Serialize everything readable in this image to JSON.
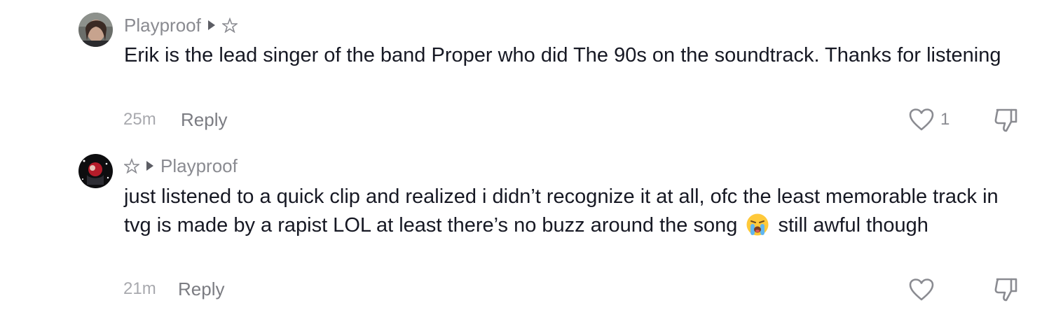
{
  "comments": [
    {
      "author": "Playproof",
      "reply_to_icon": "pentagram-icon",
      "text": "Erik is the lead singer of the band Proper who did The 90s on the soundtrack. Thanks for listening",
      "time": "25m",
      "reply_label": "Reply",
      "like_count": "1"
    },
    {
      "author_icon": "pentagram-icon",
      "reply_to": "Playproof",
      "text_before_emoji": "just listened to a quick clip and realized i didn’t recognize it at all, ofc the least memorable track in tvg is made by a rapist LOL at least there’s no buzz around the song",
      "emoji": "loudly-crying-face-emoji",
      "text_after_emoji": "still awful though",
      "time": "21m",
      "reply_label": "Reply",
      "like_count": ""
    }
  ],
  "colors": {
    "text": "#161823",
    "meta": "#8a8b91",
    "time": "#a8a9ae",
    "icon": "#8a8b91"
  }
}
